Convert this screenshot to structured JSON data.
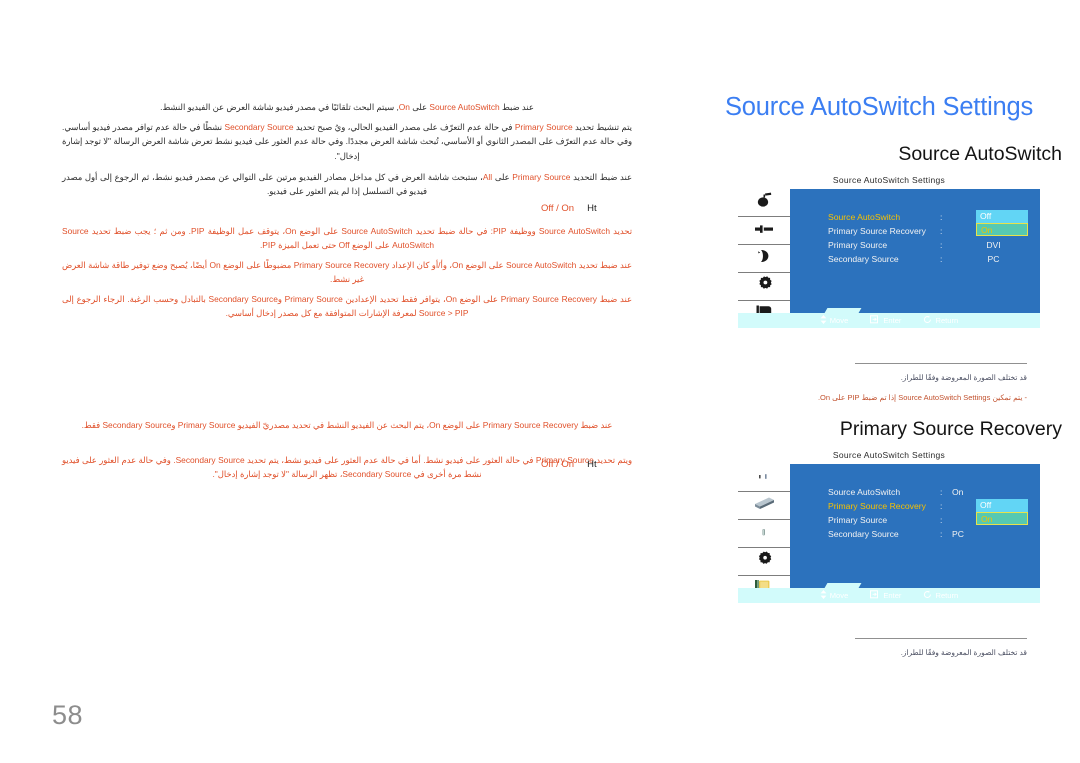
{
  "page": {
    "number": "58",
    "doc_title": "Source AutoSwitch Settings"
  },
  "sections": [
    {
      "heading": "Source AutoSwitch",
      "osd": {
        "caption": "Source AutoSwitch Settings",
        "rows": [
          {
            "label": "Source AutoSwitch",
            "colon": ":",
            "value": "",
            "active": true,
            "popup": true
          },
          {
            "label": "Primary Source Recovery",
            "colon": ":",
            "value": "",
            "active": false,
            "popup": false
          },
          {
            "label": "Primary Source",
            "colon": ":",
            "value": "DVI",
            "active": false,
            "popup": false
          },
          {
            "label": "Secondary Source",
            "colon": ":",
            "value": "PC",
            "active": false,
            "popup": false
          }
        ],
        "popup_options": [
          "Off",
          "On"
        ],
        "popup_selected": "On",
        "footer": [
          {
            "icon": "move-icon",
            "label": "Move"
          },
          {
            "icon": "enter-icon",
            "label": "Enter"
          },
          {
            "icon": "return-icon",
            "label": "Return"
          }
        ],
        "icons": [
          "picture-icon",
          "sound-icon",
          "setup-icon",
          "gear-icon",
          "multi-control-icon"
        ]
      },
      "notes": [
        "قد تختلف الصورة المعروضة وفقًا للطراز.",
        "- يتم تمكين Source AutoSwitch Settings إذا تم ضبط PIP على On."
      ]
    },
    {
      "heading": "Primary Source Recovery",
      "osd": {
        "caption": "Source AutoSwitch Settings",
        "rows": [
          {
            "label": "Source AutoSwitch",
            "colon": ":",
            "value": "On",
            "active": false,
            "popup": false
          },
          {
            "label": "Primary Source Recovery",
            "colon": ":",
            "value": "",
            "active": true,
            "popup": true
          },
          {
            "label": "Primary Source",
            "colon": ":",
            "value": "",
            "active": false,
            "popup": false
          },
          {
            "label": "Secondary Source",
            "colon": ":",
            "value": "PC",
            "active": false,
            "popup": false
          }
        ],
        "popup_options": [
          "Off",
          "On"
        ],
        "popup_selected": "On",
        "footer": [
          {
            "icon": "move-icon",
            "label": "Move"
          },
          {
            "icon": "enter-icon",
            "label": "Enter"
          },
          {
            "icon": "return-icon",
            "label": "Return"
          }
        ],
        "icons": [
          "input-icon",
          "picture-icon",
          "sound-icon",
          "gear-icon",
          "multi-control-icon"
        ]
      },
      "notes": [
        "قد تختلف الصورة المعروضة وفقًا للطراز."
      ]
    }
  ],
  "body": {
    "block1": {
      "paragraphs": [
        "عند ضبط Source AutoSwitch على On, سيتم البحث تلقائيًا في مصدر فيديو شاشة العرض عن الفيديو النشط.",
        "يتم تنشيط تحديد Primary Source في حالة عدم التعرّف على مصدر الفيديو الحالي، ويُ صبح تحديد Secondary Source نشطًا في حالة عدم توافر مصدر فيديو أساسي. وفي حالة عدم التعرّف على المصدر الثانوي أو الأساسي، تُبحث شاشة العرض مجددًا. وفي حالة عدم العثور على فيديو نشط تعرض شاشة العرض الرسالة \"لا توجد إشارة إدخال\".",
        "عند ضبط التحديد Primary Source على All، ستبحث شاشة العرض في كل مداخل مصادر الفيديو مرتين على التوالي عن مصدر فيديو نشط، ثم الرجوع إلى أول مصدر فيديو في التسلسل إذا لم يتم العثور على فيديو."
      ],
      "options_label": "Off / On",
      "options_tail": "Ht"
    },
    "block2": {
      "paragraphs": [
        "تحديد Source AutoSwitch ووظيفة PIP: في حالة ضبط تحديد Source AutoSwitch على الوضع On، يتوقف عمل الوظيفة PIP. ومن ثم ؛ يجب ضبط تحديد Source AutoSwitch على الوضع Off حتى تعمل الميزة PIP.",
        "عند ضبط تحديد Source AutoSwitch على الوضع On، وأ/أو كان الإعداد Primary Source Recovery مضبوطًا على الوضع On أيضًا، يُصبح وضع توفير طاقة شاشة العرض غير نشط.",
        "عند ضبط Primary Source Recovery على الوضع On، يتوافر فقط تحديد الإعدادين Primary Source وSecondary Source بالتبادل وحسب الرغبة. الرجاء الرجوع إلى Source > PIP لمعرفة الإشارات المتوافقة مع كل مصدر إدخال أساسي."
      ]
    },
    "block3": {
      "paragraphs": [
        "عند ضبط Primary Source Recovery على الوضع On، يتم البحث عن الفيديو النشط في تحديد مصدريّ الفيديو Primary Source وSecondary Source فقط.",
        "ويتم تحديد Primary Source في حالة العثور على فيديو نشط. أما في حالة عدم العثور على فيديو نشط، يتم تحديد Secondary Source. وفي حالة عدم العثور على فيديو نشط مرة أخرى في Secondary Source، تظهر الرسالة \"لا توجد إشارة إدخال\"."
      ],
      "options_label": "Off / On",
      "options_tail": "Ht"
    }
  },
  "colors": {
    "title_blue": "#3b7ef2",
    "keyword_orange": "#e0502a",
    "osd_blue": "#2c72bd",
    "osd_footer": "#d2fbfb",
    "highlight_off": "#62d5f5",
    "highlight_on": "#56c9b2",
    "highlight_border": "#e8e24a",
    "active_label": "#f7c100"
  }
}
